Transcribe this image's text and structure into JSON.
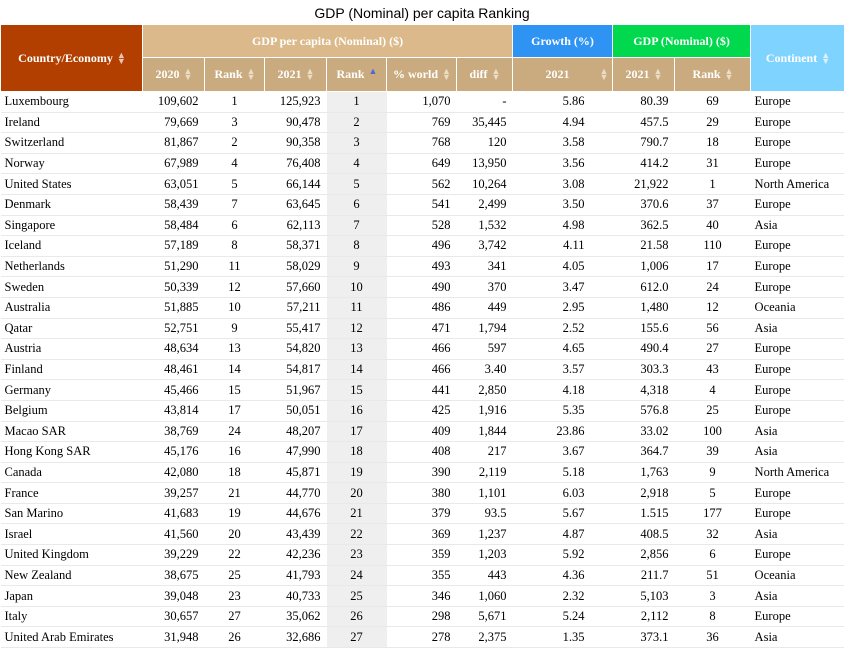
{
  "caption": "GDP (Nominal) per capita Ranking",
  "headers": {
    "country": "Country/Economy",
    "gdp_group": "GDP per capita (Nominal) ($)",
    "growth_group": "Growth (%)",
    "nominal_group": "GDP (Nominal) ($)",
    "continent": "Continent",
    "sub": {
      "y2020": "2020",
      "rank2020": "Rank",
      "y2021": "2021",
      "rank2021": "Rank",
      "world": "% world",
      "diff": "diff",
      "growth2021": "2021",
      "nominal2021": "2021",
      "nominal_rank": "Rank"
    }
  },
  "sort_icon": "sort-arrows-icon",
  "active_sort_icon": "sort-ascending-icon",
  "colors": {
    "country_header": "#b23f00",
    "gdp_header": "#dbb98a",
    "growth_header": "#2f93f4",
    "nominal_header": "#00d84d",
    "continent_header": "#7fd3ff"
  },
  "rows": [
    {
      "country": "Luxembourg",
      "v2020": "109,602",
      "r2020": "1",
      "v2021": "125,923",
      "r2021": "1",
      "world": "1,070",
      "diff": "-",
      "growth": "5.86",
      "nominal": "80.39",
      "nrank": "69",
      "continent": "Europe"
    },
    {
      "country": "Ireland",
      "v2020": "79,669",
      "r2020": "3",
      "v2021": "90,478",
      "r2021": "2",
      "world": "769",
      "diff": "35,445",
      "growth": "4.94",
      "nominal": "457.5",
      "nrank": "29",
      "continent": "Europe"
    },
    {
      "country": "Switzerland",
      "v2020": "81,867",
      "r2020": "2",
      "v2021": "90,358",
      "r2021": "3",
      "world": "768",
      "diff": "120",
      "growth": "3.58",
      "nominal": "790.7",
      "nrank": "18",
      "continent": "Europe"
    },
    {
      "country": "Norway",
      "v2020": "67,989",
      "r2020": "4",
      "v2021": "76,408",
      "r2021": "4",
      "world": "649",
      "diff": "13,950",
      "growth": "3.56",
      "nominal": "414.2",
      "nrank": "31",
      "continent": "Europe"
    },
    {
      "country": "United States",
      "v2020": "63,051",
      "r2020": "5",
      "v2021": "66,144",
      "r2021": "5",
      "world": "562",
      "diff": "10,264",
      "growth": "3.08",
      "nominal": "21,922",
      "nrank": "1",
      "continent": "North America"
    },
    {
      "country": "Denmark",
      "v2020": "58,439",
      "r2020": "7",
      "v2021": "63,645",
      "r2021": "6",
      "world": "541",
      "diff": "2,499",
      "growth": "3.50",
      "nominal": "370.6",
      "nrank": "37",
      "continent": "Europe"
    },
    {
      "country": "Singapore",
      "v2020": "58,484",
      "r2020": "6",
      "v2021": "62,113",
      "r2021": "7",
      "world": "528",
      "diff": "1,532",
      "growth": "4.98",
      "nominal": "362.5",
      "nrank": "40",
      "continent": "Asia"
    },
    {
      "country": "Iceland",
      "v2020": "57,189",
      "r2020": "8",
      "v2021": "58,371",
      "r2021": "8",
      "world": "496",
      "diff": "3,742",
      "growth": "4.11",
      "nominal": "21.58",
      "nrank": "110",
      "continent": "Europe"
    },
    {
      "country": "Netherlands",
      "v2020": "51,290",
      "r2020": "11",
      "v2021": "58,029",
      "r2021": "9",
      "world": "493",
      "diff": "341",
      "growth": "4.05",
      "nominal": "1,006",
      "nrank": "17",
      "continent": "Europe"
    },
    {
      "country": "Sweden",
      "v2020": "50,339",
      "r2020": "12",
      "v2021": "57,660",
      "r2021": "10",
      "world": "490",
      "diff": "370",
      "growth": "3.47",
      "nominal": "612.0",
      "nrank": "24",
      "continent": "Europe"
    },
    {
      "country": "Australia",
      "v2020": "51,885",
      "r2020": "10",
      "v2021": "57,211",
      "r2021": "11",
      "world": "486",
      "diff": "449",
      "growth": "2.95",
      "nominal": "1,480",
      "nrank": "12",
      "continent": "Oceania"
    },
    {
      "country": "Qatar",
      "v2020": "52,751",
      "r2020": "9",
      "v2021": "55,417",
      "r2021": "12",
      "world": "471",
      "diff": "1,794",
      "growth": "2.52",
      "nominal": "155.6",
      "nrank": "56",
      "continent": "Asia"
    },
    {
      "country": "Austria",
      "v2020": "48,634",
      "r2020": "13",
      "v2021": "54,820",
      "r2021": "13",
      "world": "466",
      "diff": "597",
      "growth": "4.65",
      "nominal": "490.4",
      "nrank": "27",
      "continent": "Europe"
    },
    {
      "country": "Finland",
      "v2020": "48,461",
      "r2020": "14",
      "v2021": "54,817",
      "r2021": "14",
      "world": "466",
      "diff": "3.40",
      "growth": "3.57",
      "nominal": "303.3",
      "nrank": "43",
      "continent": "Europe"
    },
    {
      "country": "Germany",
      "v2020": "45,466",
      "r2020": "15",
      "v2021": "51,967",
      "r2021": "15",
      "world": "441",
      "diff": "2,850",
      "growth": "4.18",
      "nominal": "4,318",
      "nrank": "4",
      "continent": "Europe"
    },
    {
      "country": "Belgium",
      "v2020": "43,814",
      "r2020": "17",
      "v2021": "50,051",
      "r2021": "16",
      "world": "425",
      "diff": "1,916",
      "growth": "5.35",
      "nominal": "576.8",
      "nrank": "25",
      "continent": "Europe"
    },
    {
      "country": "Macao SAR",
      "v2020": "38,769",
      "r2020": "24",
      "v2021": "48,207",
      "r2021": "17",
      "world": "409",
      "diff": "1,844",
      "growth": "23.86",
      "nominal": "33.02",
      "nrank": "100",
      "continent": "Asia"
    },
    {
      "country": "Hong Kong SAR",
      "v2020": "45,176",
      "r2020": "16",
      "v2021": "47,990",
      "r2021": "18",
      "world": "408",
      "diff": "217",
      "growth": "3.67",
      "nominal": "364.7",
      "nrank": "39",
      "continent": "Asia"
    },
    {
      "country": "Canada",
      "v2020": "42,080",
      "r2020": "18",
      "v2021": "45,871",
      "r2021": "19",
      "world": "390",
      "diff": "2,119",
      "growth": "5.18",
      "nominal": "1,763",
      "nrank": "9",
      "continent": "North America"
    },
    {
      "country": "France",
      "v2020": "39,257",
      "r2020": "21",
      "v2021": "44,770",
      "r2020b": "",
      "r2021": "20",
      "world": "380",
      "diff": "1,101",
      "growth": "6.03",
      "nominal": "2,918",
      "nrank": "5",
      "continent": "Europe"
    },
    {
      "country": "San Marino",
      "v2020": "41,683",
      "r2020": "19",
      "v2021": "44,676",
      "r2021": "21",
      "world": "379",
      "diff": "93.5",
      "growth": "5.67",
      "nominal": "1.515",
      "nrank": "177",
      "continent": "Europe"
    },
    {
      "country": "Israel",
      "v2020": "41,560",
      "r2020": "20",
      "v2021": "43,439",
      "r2021": "22",
      "world": "369",
      "diff": "1,237",
      "growth": "4.87",
      "nominal": "408.5",
      "nrank": "32",
      "continent": "Asia"
    },
    {
      "country": "United Kingdom",
      "v2020": "39,229",
      "r2020": "22",
      "v2021": "42,236",
      "r2021": "23",
      "world": "359",
      "diff": "1,203",
      "growth": "5.92",
      "nominal": "2,856",
      "nrank": "6",
      "continent": "Europe"
    },
    {
      "country": "New Zealand",
      "v2020": "38,675",
      "r2020": "25",
      "v2021": "41,793",
      "r2021": "24",
      "world": "355",
      "diff": "443",
      "growth": "4.36",
      "nominal": "211.7",
      "nrank": "51",
      "continent": "Oceania"
    },
    {
      "country": "Japan",
      "v2020": "39,048",
      "r2020": "23",
      "v2021": "40,733",
      "r2021": "25",
      "world": "346",
      "diff": "1,060",
      "growth": "2.32",
      "nominal": "5,103",
      "nrank": "3",
      "continent": "Asia"
    },
    {
      "country": "Italy",
      "v2020": "30,657",
      "r2020": "27",
      "v2021": "35,062",
      "r2021": "26",
      "world": "298",
      "diff": "5,671",
      "growth": "5.24",
      "nominal": "2,112",
      "nrank": "8",
      "continent": "Europe"
    },
    {
      "country": "United Arab Emirates",
      "v2020": "31,948",
      "r2020": "26",
      "v2021": "32,686",
      "r2021": "27",
      "world": "278",
      "diff": "2,375",
      "growth": "1.35",
      "nominal": "373.1",
      "nrank": "36",
      "continent": "Asia"
    }
  ]
}
